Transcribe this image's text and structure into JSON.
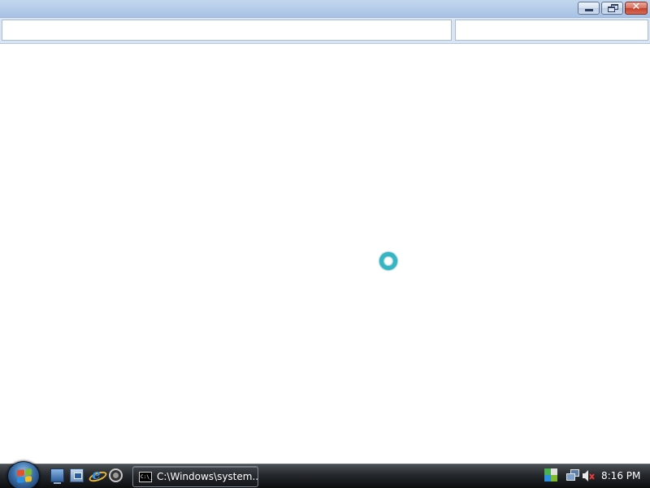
{
  "window": {
    "caption_buttons": {
      "minimize": "minimize-icon",
      "restore": "restore-icon",
      "close": "close-icon",
      "close_glyph": "✕"
    },
    "address_bar": {
      "value": "",
      "placeholder": ""
    },
    "search_box": {
      "value": "",
      "placeholder": ""
    },
    "content": {
      "cursor_state": "busy"
    }
  },
  "taskbar": {
    "start_button": {
      "icon": "windows-flag-icon"
    },
    "quick_launch": [
      {
        "icon": "show-desktop-icon"
      },
      {
        "icon": "switch-windows-icon"
      },
      {
        "icon": "internet-explorer-icon",
        "glyph": "e"
      },
      {
        "icon": "media-player-icon"
      }
    ],
    "tasks": [
      {
        "icon": "command-prompt-icon",
        "icon_text": "C:\\_",
        "label": "C:\\Windows\\system..."
      }
    ],
    "tray": {
      "icons": [
        "network-icon",
        "network-connection-icon",
        "volume-muted-icon"
      ],
      "clock": "8:16 PM"
    }
  },
  "colors": {
    "titlebar": "#b4cbe8",
    "taskbar": "#1a1d21",
    "close_button": "#c94a36",
    "busy_cursor": "#33b6c4",
    "flag_red": "#e2512e",
    "flag_green": "#7fbb2d",
    "flag_blue": "#2d8fe0",
    "flag_yellow": "#f4c01e"
  }
}
